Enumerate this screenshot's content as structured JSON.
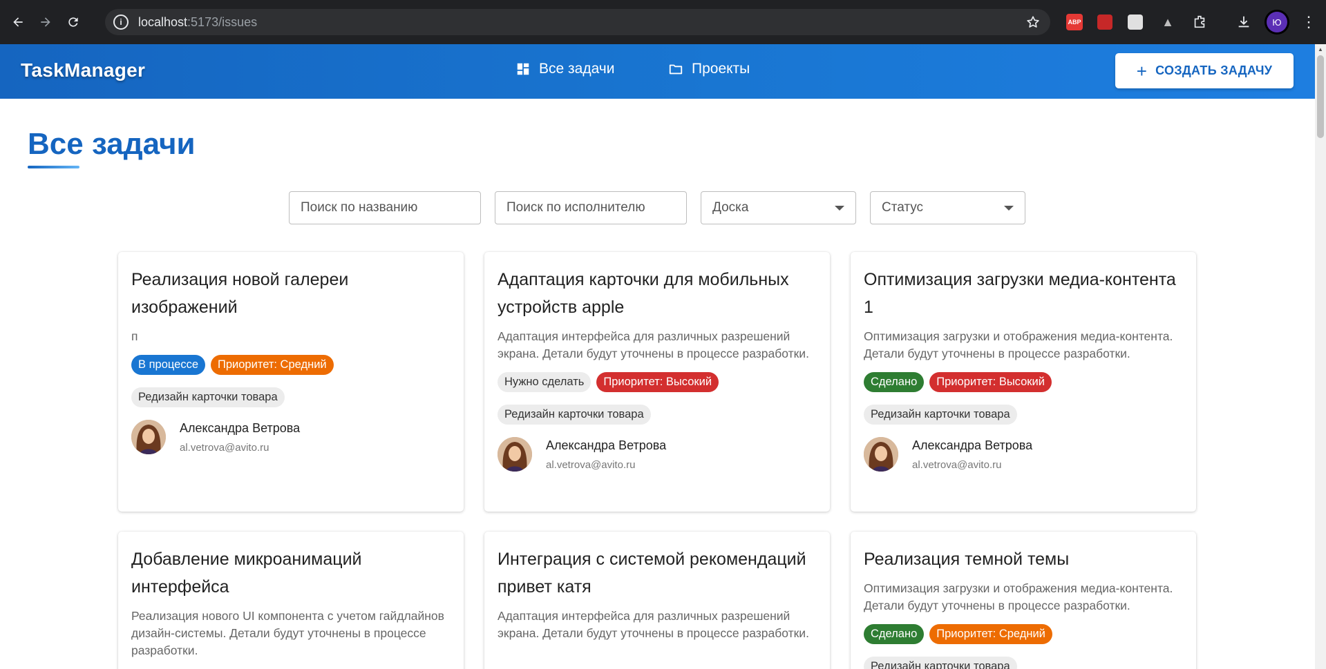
{
  "browser": {
    "url_host": "localhost",
    "url_path": ":5173/issues",
    "extension_abp": "ABP",
    "profile_initial": "Ю"
  },
  "header": {
    "brand": "TaskManager",
    "nav_all": "Все задачи",
    "nav_projects": "Проекты",
    "create_label": "Создать задачу",
    "create_icon": "+"
  },
  "page": {
    "title": "Все задачи"
  },
  "filters": {
    "title_placeholder": "Поиск по названию",
    "assignee_placeholder": "Поиск по исполнителю",
    "board_label": "Доска",
    "status_label": "Статус"
  },
  "cards": [
    {
      "title": "Реализация новой галереи изображений",
      "description": "п",
      "status": "В процессе",
      "priority": "Приоритет: Средний",
      "board": "Редизайн карточки товара",
      "assignee_name": "Александра Ветрова",
      "assignee_email": "al.vetrova@avito.ru"
    },
    {
      "title": "Адаптация карточки для мобильных устройств apple",
      "description": "Адаптация интерфейса для различных разрешений экрана. Детали будут уточнены в процессе разработки.",
      "status": "Нужно сделать",
      "priority": "Приоритет: Высокий",
      "board": "Редизайн карточки товара",
      "assignee_name": "Александра Ветрова",
      "assignee_email": "al.vetrova@avito.ru"
    },
    {
      "title": "Оптимизация загрузки медиа-контента 1",
      "description": "Оптимизация загрузки и отображения медиа-контента. Детали будут уточнены в процессе разработки.",
      "status": "Сделано",
      "priority": "Приоритет: Высокий",
      "board": "Редизайн карточки товара",
      "assignee_name": "Александра Ветрова",
      "assignee_email": "al.vetrova@avito.ru"
    },
    {
      "title": "Добавление микроанимаций интерфейса",
      "description": "Реализация нового UI компонента с учетом гайдлайнов дизайн-системы. Детали будут уточнены в процессе разработки."
    },
    {
      "title": "Интеграция с системой рекомендаций привет катя",
      "description": "Адаптация интерфейса для различных разрешений экрана. Детали будут уточнены в процессе разработки."
    },
    {
      "title": "Реализация темной темы",
      "description": "Оптимизация загрузки и отображения медиа-контента. Детали будут уточнены в процессе разработки.",
      "status": "Сделано",
      "priority": "Приоритет: Средний",
      "board": "Редизайн карточки товара"
    }
  ],
  "colors": {
    "brand": "#1565c0",
    "status_in_progress": "#1976d2",
    "status_done": "#2e7d32",
    "status_todo": "#ececec",
    "priority_medium": "#ed6c02",
    "priority_high": "#d32f2f"
  },
  "icons": {
    "back": "arrow-left-icon",
    "forward": "arrow-right-icon",
    "reload": "reload-icon",
    "site_info": "info-icon",
    "bookmark": "star-icon",
    "nav_all": "dashboard-grid-icon",
    "nav_projects": "folder-icon",
    "create": "plus-icon",
    "select_caret": "caret-down-icon"
  }
}
